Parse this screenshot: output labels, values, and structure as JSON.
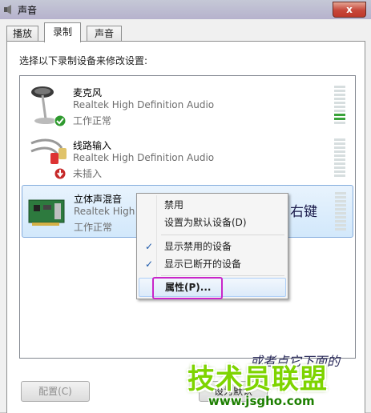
{
  "window": {
    "title": "声音",
    "close": "x"
  },
  "tabs": [
    {
      "label": "播放",
      "active": false
    },
    {
      "label": "录制",
      "active": true
    },
    {
      "label": "声音",
      "active": false
    }
  ],
  "instruction": "选择以下录制设备来修改设置:",
  "devices": [
    {
      "name": "麦克风",
      "description": "Realtek High Definition Audio",
      "status": "工作正常",
      "badge": "check-badge-icon",
      "icon": "microphone-icon",
      "level": "partial"
    },
    {
      "name": "线路输入",
      "description": "Realtek High Definition Audio",
      "status": "未插入",
      "badge": "down-arrow-badge-icon",
      "icon": "line-in-cable-icon",
      "level": "none"
    },
    {
      "name": "立体声混音",
      "description": "Realtek High",
      "status": "工作正常",
      "icon": "sound-card-icon",
      "selected": true
    }
  ],
  "context_menu": {
    "items": [
      {
        "label": "禁用",
        "checked": false
      },
      {
        "label": "设置为默认设备(D)",
        "checked": false
      },
      {
        "label": "显示禁用的设备",
        "checked": true
      },
      {
        "label": "显示已断开的设备",
        "checked": true
      },
      {
        "label": "属性(P)...",
        "checked": false,
        "highlighted": true
      }
    ]
  },
  "annotations": {
    "right_click": "右键",
    "lower": "或者点它下面的"
  },
  "buttons": {
    "configure": "配置(C)",
    "set_default": "设为默认"
  },
  "watermark": {
    "brand": "技术员联盟",
    "url": "www.jsgho.com"
  },
  "colors": {
    "annotation_pink": "#cc33cc",
    "watermark_green": "#7ed400",
    "meter_green": "#3aa33a"
  }
}
